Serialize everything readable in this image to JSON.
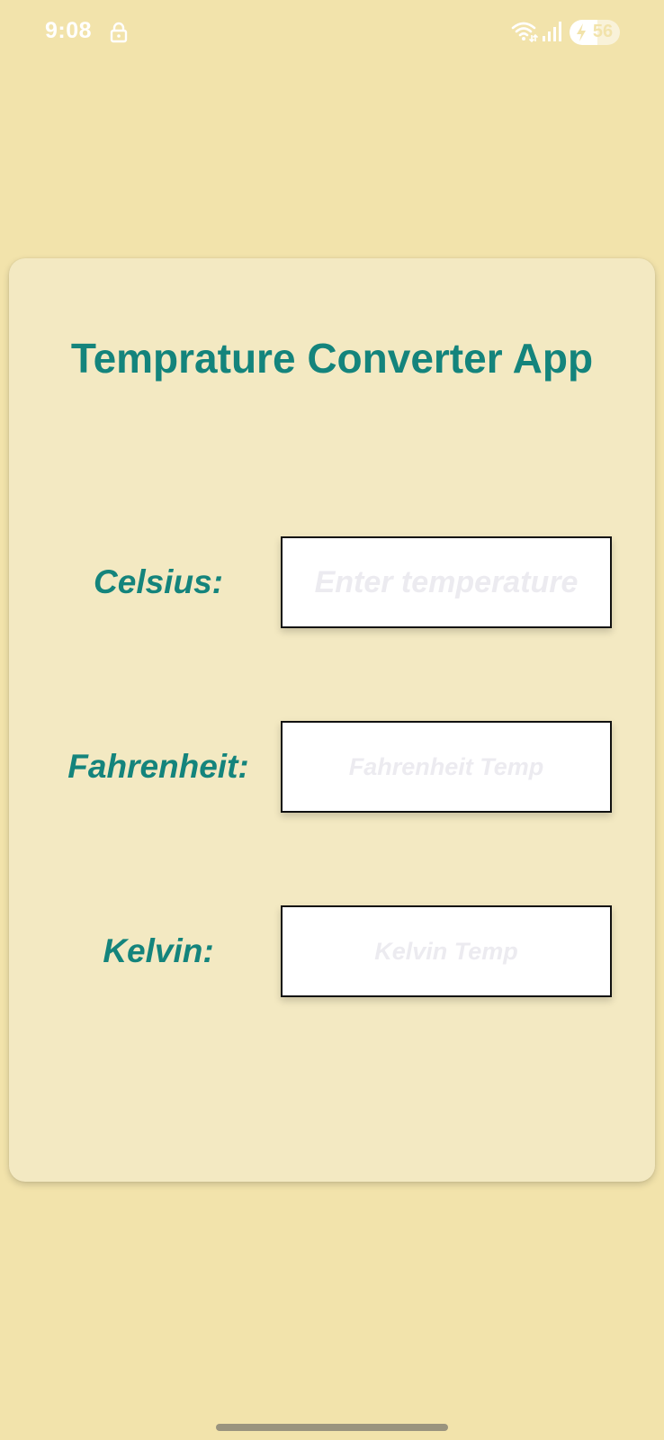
{
  "status_bar": {
    "time": "9:08",
    "battery_level": "56",
    "icons": [
      "lock-icon",
      "wifi-icon",
      "signal-icon",
      "battery-charging-icon"
    ]
  },
  "app": {
    "title": "Temprature Converter App"
  },
  "fields": {
    "celsius": {
      "label": "Celsius:",
      "value": "",
      "placeholder": "Enter temperature"
    },
    "fahrenheit": {
      "label": "Fahrenheit:",
      "value": "",
      "placeholder": "Fahrenheit Temp"
    },
    "kelvin": {
      "label": "Kelvin:",
      "value": "",
      "placeholder": "Kelvin Temp"
    }
  },
  "colors": {
    "background": "#f2e3ab",
    "card": "#f3e9c2",
    "accent": "#14847c",
    "input_background": "#ffffff",
    "placeholder": "#ecebf0"
  }
}
